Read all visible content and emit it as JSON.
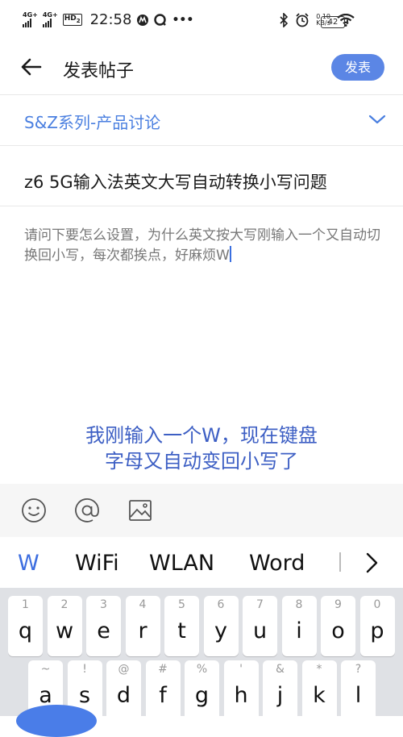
{
  "status_bar": {
    "signal1": "4G+",
    "signal2": "4G+",
    "hd_label": "HD",
    "hd_sub": "2",
    "time": "22:58",
    "speed_value": "0.10",
    "speed_unit": "KB/s",
    "battery": "42"
  },
  "header": {
    "title": "发表帖子",
    "publish_label": "发表"
  },
  "category": {
    "selected": "S&Z系列-产品讨论"
  },
  "post": {
    "title": "z6 5G输入法英文大写自动转换小写问题",
    "body": "请问下要怎么设置，为什么英文按大写刚输入一个又自动切换回小写，每次都挨点，好麻烦W"
  },
  "annotation": {
    "line1": "我刚输入一个W，现在键盘",
    "line2": "字母又自动变回小写了"
  },
  "toolbar": {
    "icons": [
      "emoji-icon",
      "mention-icon",
      "image-icon"
    ]
  },
  "suggestions": [
    "W",
    "WiFi",
    "WLAN",
    "Word"
  ],
  "keyboard": {
    "row1": [
      {
        "num": "1",
        "letter": "q"
      },
      {
        "num": "2",
        "letter": "w"
      },
      {
        "num": "3",
        "letter": "e"
      },
      {
        "num": "4",
        "letter": "r"
      },
      {
        "num": "5",
        "letter": "t"
      },
      {
        "num": "6",
        "letter": "y"
      },
      {
        "num": "7",
        "letter": "u"
      },
      {
        "num": "8",
        "letter": "i"
      },
      {
        "num": "9",
        "letter": "o"
      },
      {
        "num": "0",
        "letter": "p"
      }
    ],
    "row2": [
      {
        "num": "~",
        "letter": "a"
      },
      {
        "num": "!",
        "letter": "s"
      },
      {
        "num": "@",
        "letter": "d"
      },
      {
        "num": "#",
        "letter": "f"
      },
      {
        "num": "%",
        "letter": "g"
      },
      {
        "num": "'",
        "letter": "h"
      },
      {
        "num": "&",
        "letter": "j"
      },
      {
        "num": "*",
        "letter": "k"
      },
      {
        "num": "?",
        "letter": "l"
      }
    ]
  },
  "colors": {
    "accent": "#4a7fe0",
    "publish_bg": "#5b86e5",
    "annotation": "#3d5fc4"
  }
}
